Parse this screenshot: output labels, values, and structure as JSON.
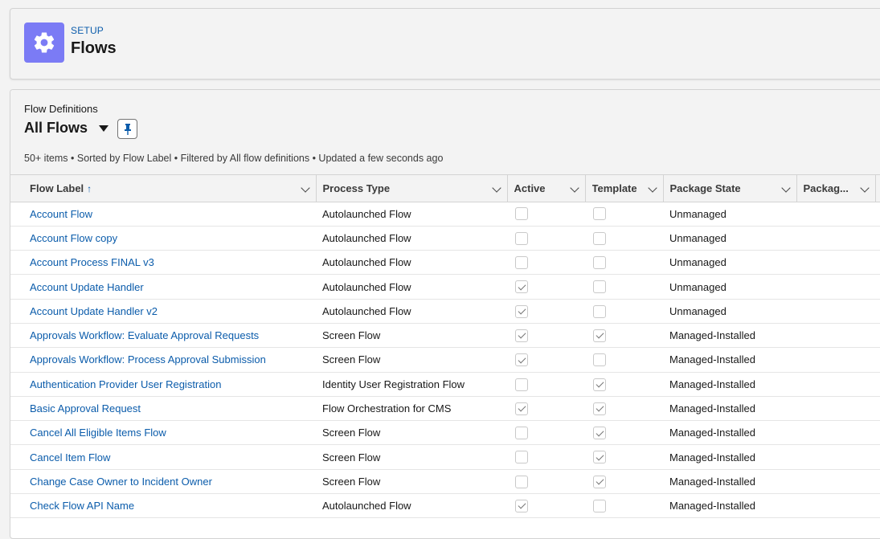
{
  "header": {
    "section": "SETUP",
    "title": "Flows",
    "icon": "gear-icon",
    "icon_color": "#7b7bf5"
  },
  "list": {
    "object_label": "Flow Definitions",
    "view_name": "All Flows",
    "meta": "50+ items • Sorted by Flow Label • Filtered by All flow definitions • Updated a few seconds ago",
    "columns": [
      {
        "label": "Flow Label",
        "sorted": "ascending"
      },
      {
        "label": "Process Type"
      },
      {
        "label": "Active"
      },
      {
        "label": "Template"
      },
      {
        "label": "Package State"
      },
      {
        "label": "Packag..."
      }
    ],
    "rows": [
      {
        "label": "Account Flow",
        "type": "Autolaunched Flow",
        "active": false,
        "template": false,
        "state": "Unmanaged"
      },
      {
        "label": "Account Flow copy",
        "type": "Autolaunched Flow",
        "active": false,
        "template": false,
        "state": "Unmanaged"
      },
      {
        "label": "Account Process FINAL v3",
        "type": "Autolaunched Flow",
        "active": false,
        "template": false,
        "state": "Unmanaged"
      },
      {
        "label": "Account Update Handler",
        "type": "Autolaunched Flow",
        "active": true,
        "template": false,
        "state": "Unmanaged"
      },
      {
        "label": "Account Update Handler v2",
        "type": "Autolaunched Flow",
        "active": true,
        "template": false,
        "state": "Unmanaged"
      },
      {
        "label": "Approvals Workflow: Evaluate Approval Requests",
        "type": "Screen Flow",
        "active": true,
        "template": true,
        "state": "Managed-Installed"
      },
      {
        "label": "Approvals Workflow: Process Approval Submission",
        "type": "Screen Flow",
        "active": true,
        "template": false,
        "state": "Managed-Installed"
      },
      {
        "label": "Authentication Provider User Registration",
        "type": "Identity User Registration Flow",
        "active": false,
        "template": true,
        "state": "Managed-Installed"
      },
      {
        "label": "Basic Approval Request",
        "type": "Flow Orchestration for CMS",
        "active": true,
        "template": true,
        "state": "Managed-Installed"
      },
      {
        "label": "Cancel All Eligible Items Flow",
        "type": "Screen Flow",
        "active": false,
        "template": true,
        "state": "Managed-Installed"
      },
      {
        "label": "Cancel Item Flow",
        "type": "Screen Flow",
        "active": false,
        "template": true,
        "state": "Managed-Installed"
      },
      {
        "label": "Change Case Owner to Incident Owner",
        "type": "Screen Flow",
        "active": false,
        "template": true,
        "state": "Managed-Installed"
      },
      {
        "label": "Check Flow API Name",
        "type": "Autolaunched Flow",
        "active": true,
        "template": false,
        "state": "Managed-Installed"
      }
    ]
  },
  "colors": {
    "link": "#0b5cab",
    "background": "#f3f3f3"
  }
}
